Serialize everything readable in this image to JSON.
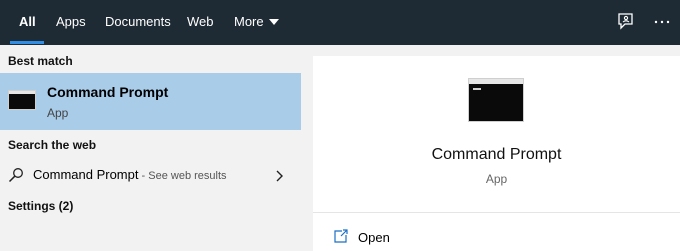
{
  "tabs": [
    {
      "label": "All",
      "active": true
    },
    {
      "label": "Apps"
    },
    {
      "label": "Documents"
    },
    {
      "label": "Web"
    },
    {
      "label": "More"
    }
  ],
  "top_icons": [
    "feedback-icon",
    "more-options-icon"
  ],
  "best_match": {
    "heading": "Best match",
    "title": "Command Prompt",
    "subtitle": "App",
    "icon": "command-prompt-icon"
  },
  "search_web": {
    "heading": "Search the web",
    "query": "Command Prompt",
    "hint": " - See web results",
    "icon": "search-icon"
  },
  "settings": {
    "heading": "Settings (2)"
  },
  "preview": {
    "title": "Command Prompt",
    "subtitle": "App",
    "actions": [
      {
        "label": "Open",
        "icon": "open-icon"
      }
    ]
  },
  "colors": {
    "topbar": "#1f2b34",
    "accent": "#2e8ee8",
    "selected_row": "#a9cce9",
    "pane_bg": "#f2f2f2"
  }
}
